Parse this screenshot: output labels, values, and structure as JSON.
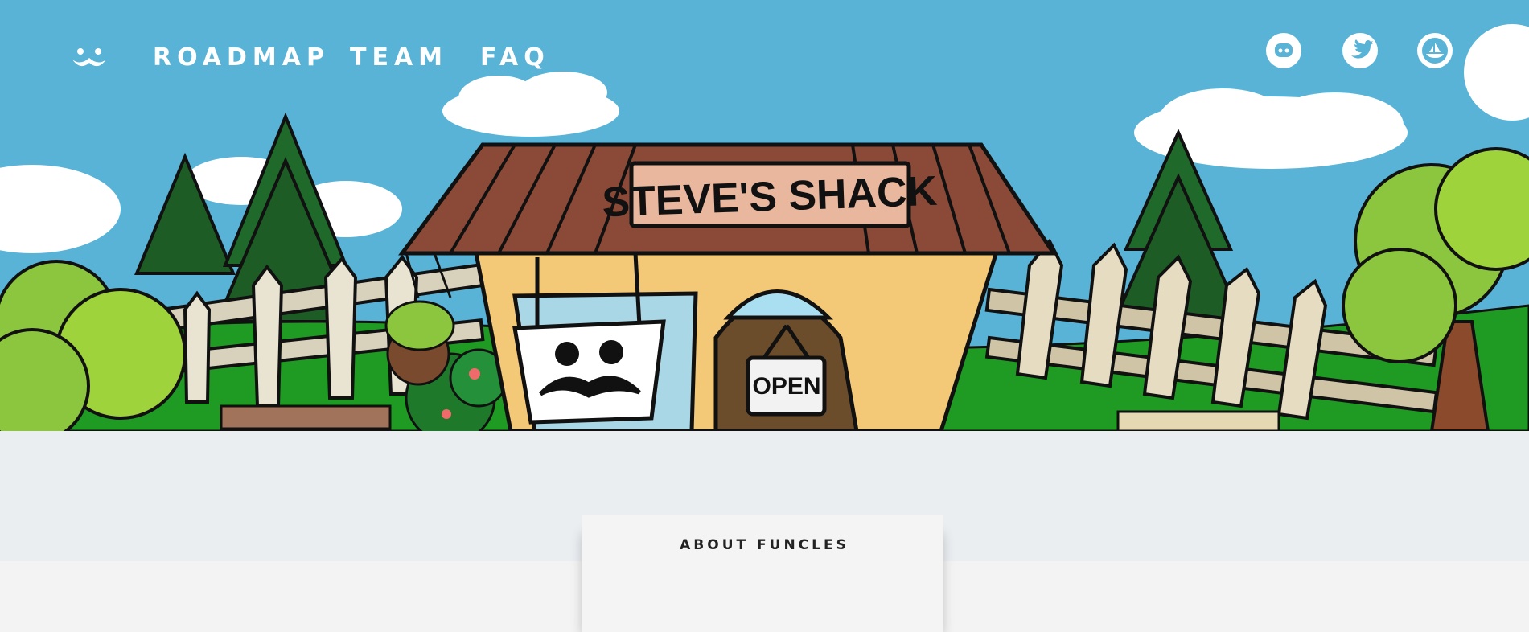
{
  "nav": {
    "logo_icon": "mustache-face-icon",
    "links": [
      "ROADMAP",
      "TEAM",
      "FAQ"
    ]
  },
  "social": [
    {
      "icon": "discord-icon"
    },
    {
      "icon": "twitter-icon"
    },
    {
      "icon": "opensea-icon"
    }
  ],
  "hero": {
    "sign_text": "STEVE'S SHACK",
    "door_sign": "OPEN",
    "sky_color": "#58b3d7",
    "grass_color": "#1f9a23"
  },
  "about": {
    "title": "ABOUT FUNCLES"
  }
}
